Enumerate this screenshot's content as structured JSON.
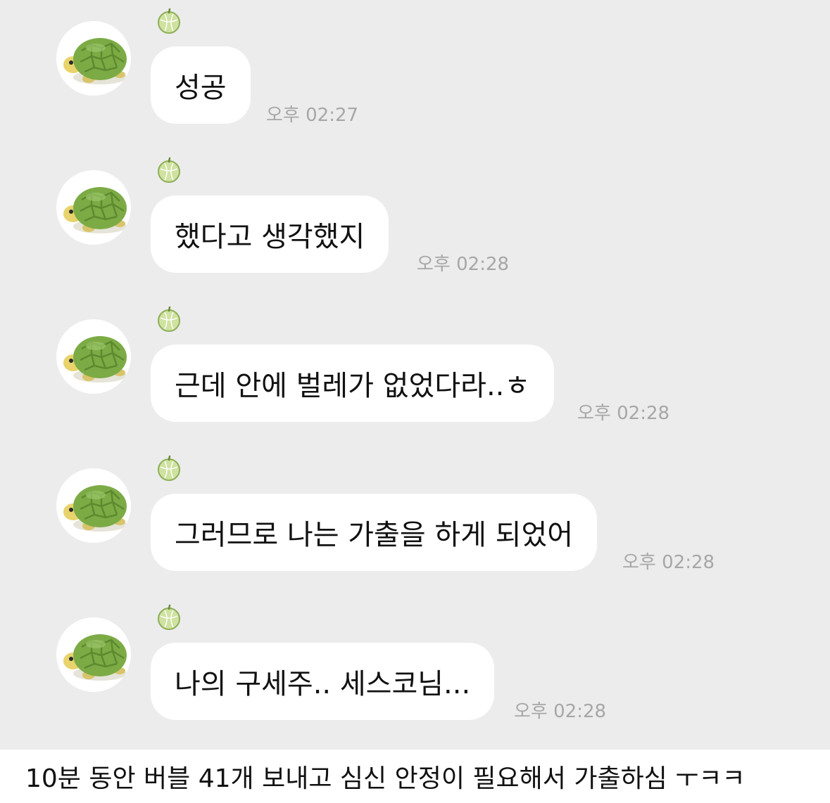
{
  "messages": [
    {
      "text": "성공",
      "time": "오후 02:27"
    },
    {
      "text": "했다고 생각했지",
      "time": "오후 02:28"
    },
    {
      "text": "근데 안에 벌레가 없었다라..ㅎ",
      "time": "오후 02:28"
    },
    {
      "text": "그러므로 나는 가출을 하게 되었어",
      "time": "오후 02:28"
    },
    {
      "text": "나의 구세주.. 세스코님...",
      "time": "오후 02:28"
    }
  ],
  "caption": "10분 동안 버블 41개 보내고 심신 안정이 필요해서 가출하심 ㅜㅋㅋ",
  "icons": {
    "avatar": "turtle-avatar-icon",
    "badge": "melon-badge-icon"
  },
  "colors": {
    "chat_bg": "#ececec",
    "bubble": "#ffffff",
    "time": "#a7a7a7"
  }
}
